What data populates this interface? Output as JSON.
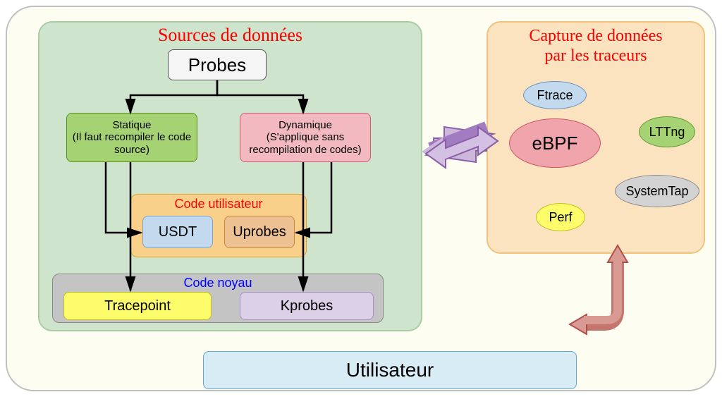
{
  "sources": {
    "title": "Sources de données",
    "probes": "Probes",
    "statique": "Statique\n(Il faut recompiler le code source)",
    "dynamique": "Dynamique\n(S'applique sans recompilation de codes)",
    "code_utilisateur": {
      "title": "Code utilisateur",
      "usdt": "USDT",
      "uprobes": "Uprobes"
    },
    "code_noyau": {
      "title": "Code noyau",
      "tracepoint": "Tracepoint",
      "kprobes": "Kprobes"
    }
  },
  "capture": {
    "title": "Capture de données\npar les traceurs",
    "tracers": {
      "ftrace": "Ftrace",
      "ebpf": "eBPF",
      "lttng": "LTTng",
      "systemtap": "SystemTap",
      "perf": "Perf"
    }
  },
  "utilisateur": "Utilisateur"
}
